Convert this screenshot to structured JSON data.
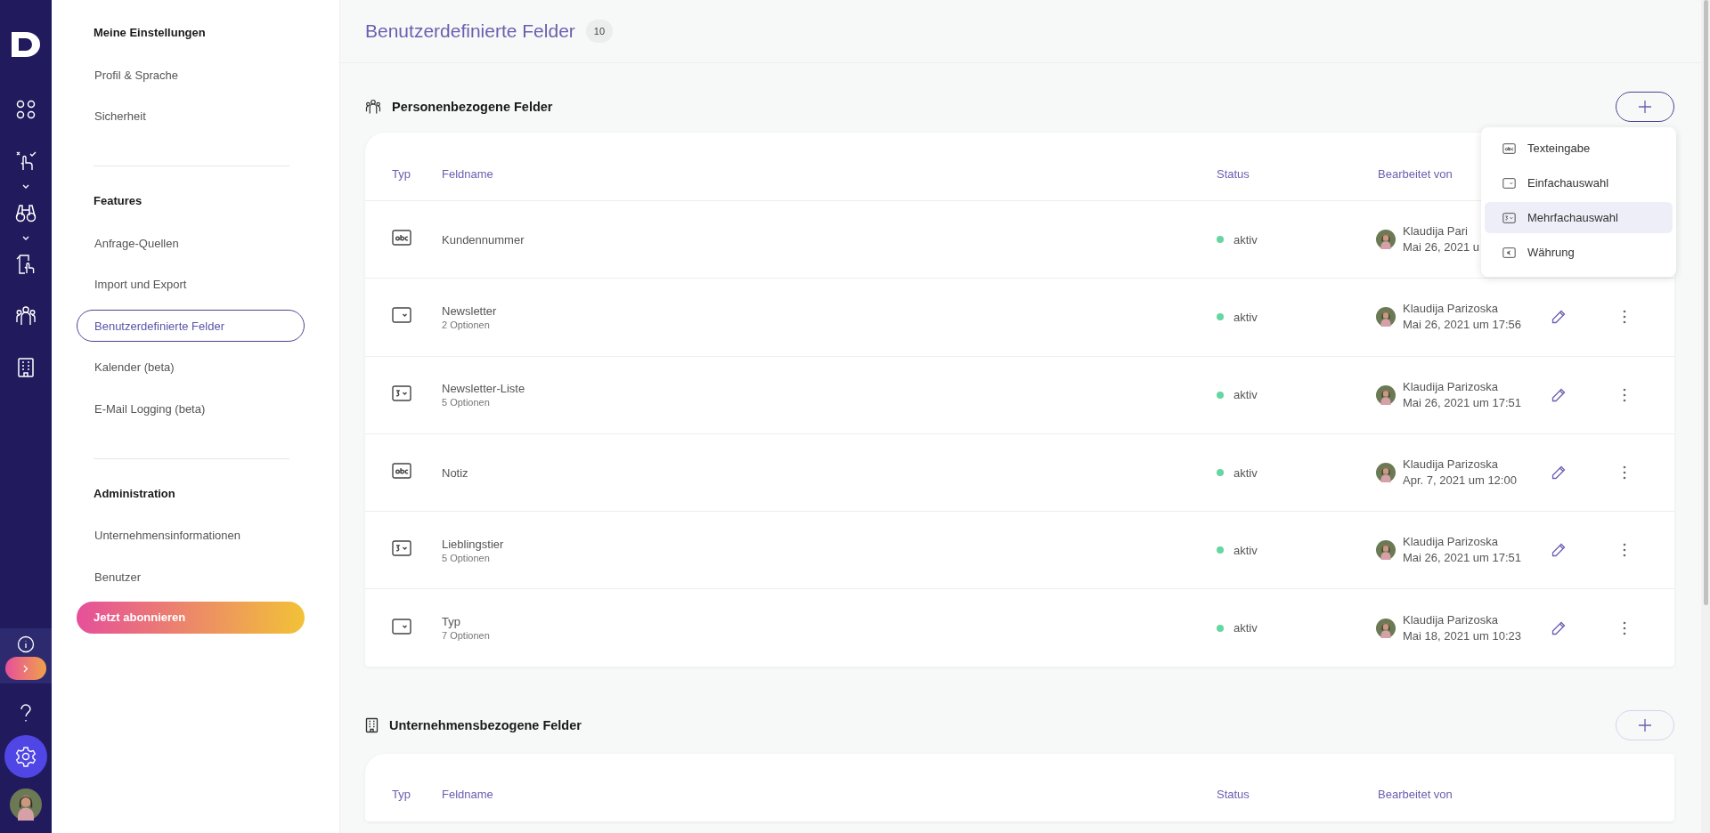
{
  "rail": {
    "items": [
      {
        "kind": "apps",
        "selected": false
      },
      {
        "kind": "hand",
        "selected": false
      },
      {
        "kind": "binoculars",
        "selected": false
      },
      {
        "kind": "document",
        "selected": false
      },
      {
        "kind": "people",
        "selected": false
      },
      {
        "kind": "building",
        "selected": false
      }
    ],
    "bottom": [
      {
        "kind": "info",
        "selected": false
      },
      {
        "kind": "expand",
        "selected": false
      },
      {
        "kind": "help",
        "selected": false
      },
      {
        "kind": "settings",
        "selected": true
      },
      {
        "kind": "avatar",
        "selected": false
      }
    ]
  },
  "settings_nav": {
    "sections": [
      {
        "heading": "Meine Einstellungen",
        "items": [
          {
            "label": "Profil & Sprache",
            "selected": false
          },
          {
            "label": "Sicherheit",
            "selected": false
          }
        ]
      },
      {
        "heading": "Features",
        "items": [
          {
            "label": "Anfrage-Quellen",
            "selected": false
          },
          {
            "label": "Import und Export",
            "selected": false
          },
          {
            "label": "Benutzerdefinierte Felder",
            "selected": true
          },
          {
            "label": "Kalender (beta)",
            "selected": false
          },
          {
            "label": "E-Mail Logging (beta)",
            "selected": false
          }
        ]
      },
      {
        "heading": "Administration",
        "items": [
          {
            "label": "Unternehmensinformationen",
            "selected": false
          },
          {
            "label": "Benutzer",
            "selected": false
          }
        ]
      }
    ],
    "subscribe_button": "Jetzt abonnieren"
  },
  "page": {
    "title": "Benutzerdefinierte Felder",
    "count": "10"
  },
  "sections": [
    {
      "kind": "people",
      "title": "Personenbezogene Felder",
      "columns": [
        "Typ",
        "Feldname",
        "Status",
        "Bearbeitet von"
      ],
      "rows": [
        {
          "kind": "text",
          "name": "Kundennummer",
          "status": "aktiv",
          "editor": "Klaudija Pari",
          "date": "Mai 26, 2021 u"
        },
        {
          "kind": "single",
          "name": "Newsletter",
          "options": "2 Optionen",
          "status": "aktiv",
          "editor": "Klaudija Parizoska",
          "date": "Mai 26, 2021 um 17:56"
        },
        {
          "kind": "multi",
          "name": "Newsletter-Liste",
          "options": "5 Optionen",
          "status": "aktiv",
          "editor": "Klaudija Parizoska",
          "date": "Mai 26, 2021 um 17:51"
        },
        {
          "kind": "text",
          "name": "Notiz",
          "status": "aktiv",
          "editor": "Klaudija Parizoska",
          "date": "Apr. 7, 2021 um 12:00"
        },
        {
          "kind": "multi",
          "name": "Lieblingstier",
          "options": "5 Optionen",
          "status": "aktiv",
          "editor": "Klaudija Parizoska",
          "date": "Mai 26, 2021 um 17:51"
        },
        {
          "kind": "single",
          "name": "Typ",
          "options": "7 Optionen",
          "status": "aktiv",
          "editor": "Klaudija Parizoska",
          "date": "Mai 18, 2021 um 10:23"
        }
      ],
      "add_menu": {
        "items": [
          {
            "kind": "text",
            "label": "Texteingabe",
            "selected": false
          },
          {
            "kind": "single",
            "label": "Einfachauswahl",
            "selected": false
          },
          {
            "kind": "multi",
            "label": "Mehrfachauswahl",
            "selected": true
          },
          {
            "kind": "currency",
            "label": "Währung",
            "selected": false
          }
        ]
      }
    },
    {
      "kind": "building",
      "title": "Unternehmensbezogene Felder",
      "columns": [
        "Typ",
        "Feldname",
        "Status",
        "Bearbeitet von"
      ]
    }
  ]
}
